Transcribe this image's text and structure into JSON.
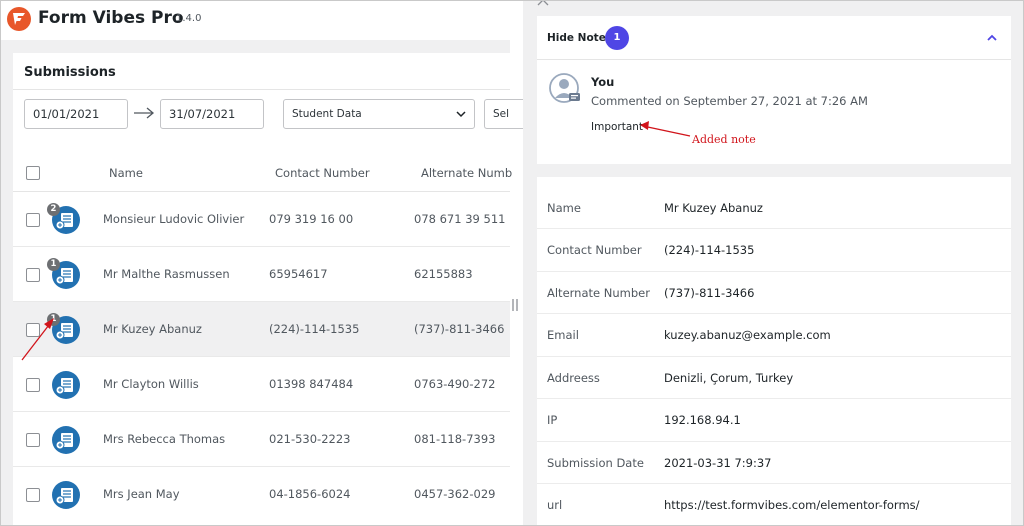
{
  "app": {
    "title": "Form Vibes Pro",
    "version": "1.4.0"
  },
  "panel": {
    "title": "Submissions"
  },
  "filters": {
    "date_from": "01/01/2021",
    "date_to": "31/07/2021",
    "form_select": "Student Data",
    "second_select": "Sel"
  },
  "table": {
    "columns": [
      "Name",
      "Contact Number",
      "Alternate Numb"
    ],
    "rows": [
      {
        "notes": "2",
        "name": "Monsieur Ludovic Olivier",
        "contact": "079 319 16 00",
        "alternate": "078 671 39 511"
      },
      {
        "notes": "1",
        "name": "Mr Malthe Rasmussen",
        "contact": "65954617",
        "alternate": "62155883"
      },
      {
        "notes": "1",
        "name": "Mr Kuzey Abanuz",
        "contact": "(224)-114-1535",
        "alternate": "(737)-811-3466"
      },
      {
        "notes": "",
        "name": "Mr Clayton Willis",
        "contact": "01398 847484",
        "alternate": "0763-490-272"
      },
      {
        "notes": "",
        "name": "Mrs Rebecca Thomas",
        "contact": "021-530-2223",
        "alternate": "081-118-7393"
      },
      {
        "notes": "",
        "name": "Mrs Jean May",
        "contact": "04-1856-6024",
        "alternate": "0457-362-029"
      }
    ]
  },
  "notes": {
    "toggle_label": "Hide Notes",
    "count": "1",
    "author": "You",
    "meta": "Commented on September 27, 2021 at 7:26 AM",
    "text": "Important",
    "annotation": "Added note"
  },
  "details": {
    "fields": [
      {
        "label": "Name",
        "value": "Mr Kuzey Abanuz"
      },
      {
        "label": "Contact Number",
        "value": "(224)-114-1535"
      },
      {
        "label": "Alternate Number",
        "value": "(737)-811-3466"
      },
      {
        "label": "Email",
        "value": "kuzey.abanuz@example.com"
      },
      {
        "label": "Addreess",
        "value": "Denizli, Çorum, Turkey"
      },
      {
        "label": "IP",
        "value": "192.168.94.1"
      },
      {
        "label": "Submission Date",
        "value": "2021-03-31 7:9:37"
      },
      {
        "label": "url",
        "value": "https://test.formvibes.com/elementor-forms/"
      }
    ]
  },
  "colors": {
    "accent": "#4f46e5",
    "logo": "#e8572a",
    "note_icon": "#2271b1",
    "annotation": "#d1141b"
  }
}
